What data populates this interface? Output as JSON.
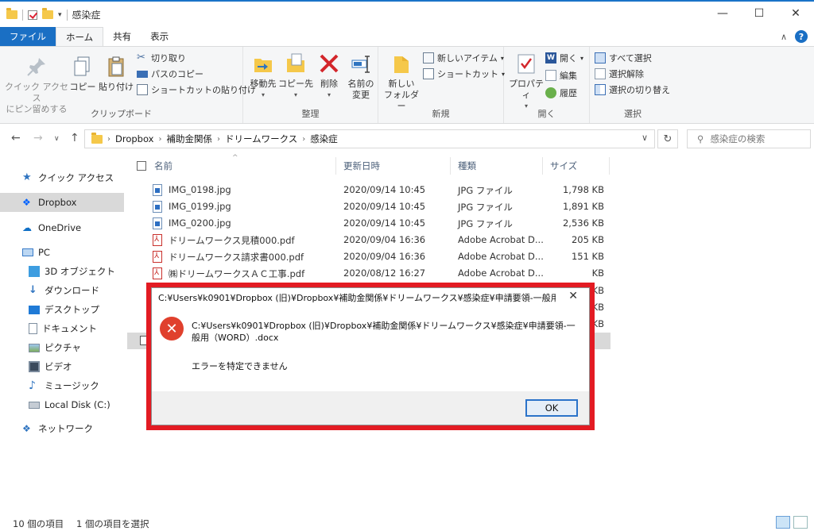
{
  "window": {
    "title": "感染症",
    "buttons": {
      "minimize": "—",
      "maximize": "☐",
      "close": "✕"
    }
  },
  "tabs": [
    {
      "label": "ファイル"
    },
    {
      "label": "ホーム"
    },
    {
      "label": "共有"
    },
    {
      "label": "表示"
    }
  ],
  "ribbon": {
    "clipboard": {
      "label": "クリップボード",
      "pin": "クイック アクセス\nにピン留めする",
      "pin_line1": "クイック アクセス",
      "pin_line2": "にピン留めする",
      "copy": "コピー",
      "paste": "貼り付け",
      "cut": "切り取り",
      "copy_path": "パスのコピー",
      "paste_shortcut": "ショートカットの貼り付け"
    },
    "organize": {
      "label": "整理",
      "move_to": "移動先",
      "copy_to": "コピー先",
      "delete": "削除",
      "rename_line1": "名前の",
      "rename_line2": "変更"
    },
    "new": {
      "label": "新規",
      "new_folder_line1": "新しい",
      "new_folder_line2": "フォルダー",
      "new_item": "新しいアイテム",
      "shortcut": "ショートカット"
    },
    "open": {
      "label": "開く",
      "properties": "プロパティ",
      "open": "開く",
      "edit": "編集",
      "history": "履歴"
    },
    "select": {
      "label": "選択",
      "select_all": "すべて選択",
      "select_none": "選択解除",
      "invert": "選択の切り替え"
    }
  },
  "address": {
    "crumbs": [
      "Dropbox",
      "補助金関係",
      "ドリームワークス",
      "感染症"
    ],
    "search_placeholder": "感染症の検索"
  },
  "sidebar": {
    "items": [
      {
        "label": "クイック アクセス"
      },
      {
        "label": "Dropbox"
      },
      {
        "label": "OneDrive"
      },
      {
        "label": "PC"
      },
      {
        "label": "3D オブジェクト"
      },
      {
        "label": "ダウンロード"
      },
      {
        "label": "デスクトップ"
      },
      {
        "label": "ドキュメント"
      },
      {
        "label": "ピクチャ"
      },
      {
        "label": "ビデオ"
      },
      {
        "label": "ミュージック"
      },
      {
        "label": "Local Disk (C:)"
      },
      {
        "label": "ネットワーク"
      }
    ]
  },
  "columns": {
    "name": "名前",
    "date": "更新日時",
    "type": "種類",
    "size": "サイズ"
  },
  "files": [
    {
      "name": "IMG_0198.jpg",
      "date": "2020/09/14 10:45",
      "type": "JPG ファイル",
      "size": "1,798 KB"
    },
    {
      "name": "IMG_0199.jpg",
      "date": "2020/09/14 10:45",
      "type": "JPG ファイル",
      "size": "1,891 KB"
    },
    {
      "name": "IMG_0200.jpg",
      "date": "2020/09/14 10:45",
      "type": "JPG ファイル",
      "size": "2,536 KB"
    },
    {
      "name": "ドリームワークス見積000.pdf",
      "date": "2020/09/04 16:36",
      "type": "Adobe Acrobat D...",
      "size": "205 KB"
    },
    {
      "name": "ドリームワークス請求書000.pdf",
      "date": "2020/09/04 16:36",
      "type": "Adobe Acrobat D...",
      "size": "151 KB"
    },
    {
      "name": "㈱ドリームワークスＡＣ工事.pdf",
      "date": "2020/08/12 16:27",
      "type": "Adobe Acrobat D...",
      "size": "KB"
    }
  ],
  "hidden_row_sizes": [
    "KB",
    "KB",
    "KB"
  ],
  "status": {
    "count": "10 個の項目",
    "selected": "1 個の項目を選択"
  },
  "dialog": {
    "title": "C:¥Users¥k0901¥Dropbox (旧)¥Dropbox¥補助金関係¥ドリームワークス¥感染症¥申請要領-一般用（...",
    "message": "C:¥Users¥k0901¥Dropbox (旧)¥Dropbox¥補助金関係¥ドリームワークス¥感染症¥申請要領-一般用（WORD）.docx",
    "error": "エラーを特定できません",
    "ok": "OK"
  },
  "colors": {
    "highlight": "#e31b23",
    "file_tab": "#1a6fc4",
    "error_icon": "#e0402d"
  }
}
